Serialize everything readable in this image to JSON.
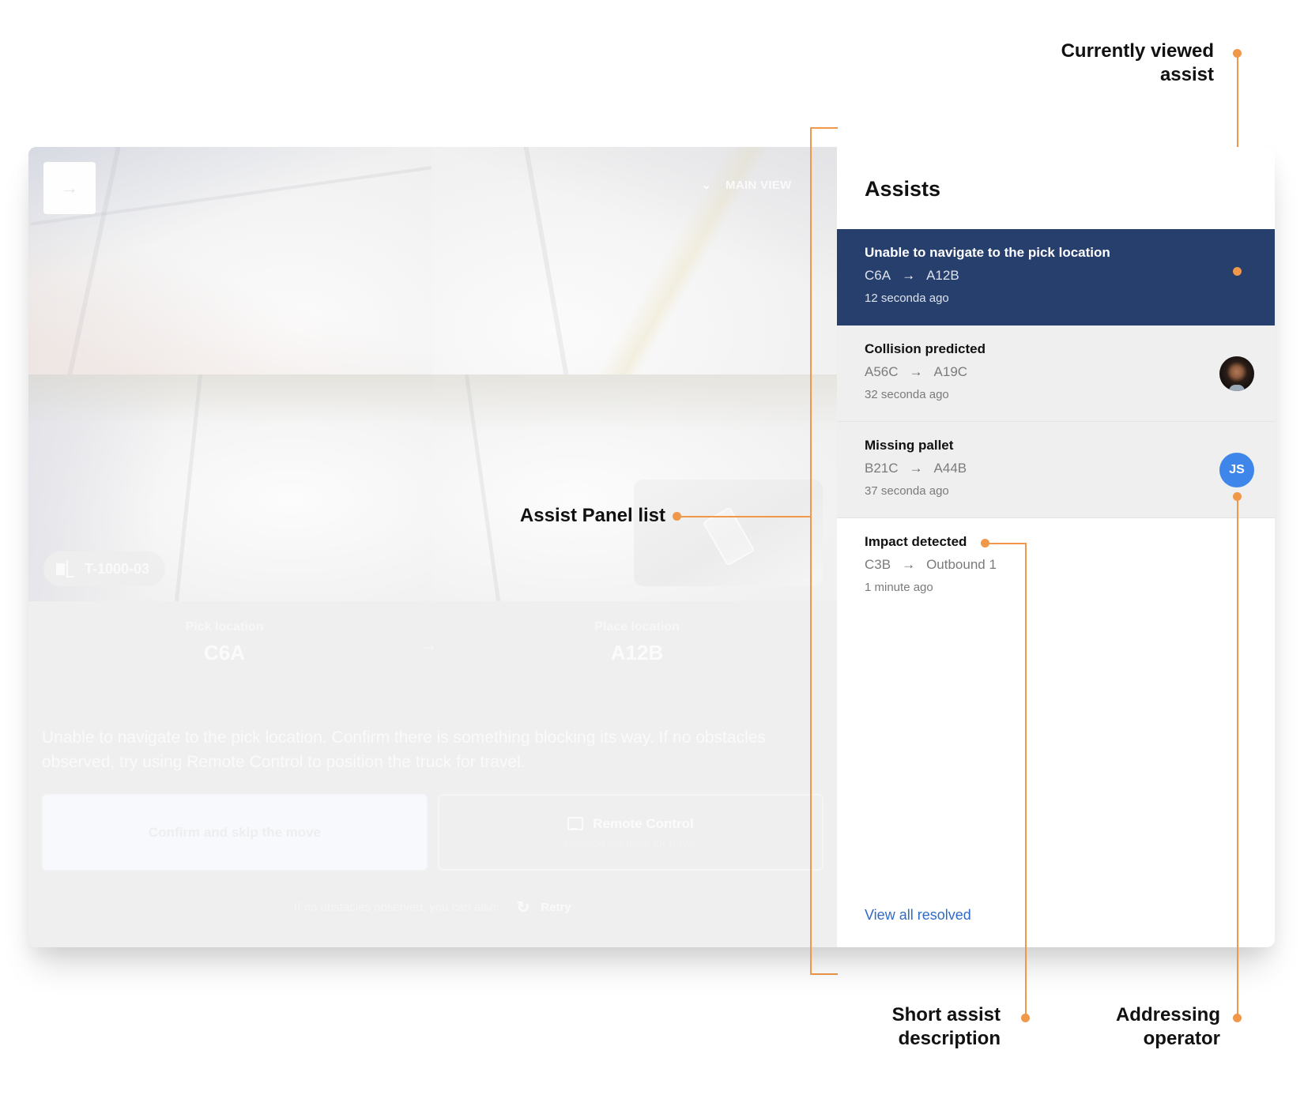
{
  "annotations": {
    "currently_viewed": "Currently viewed assist",
    "currently_viewed_l1": "Currently viewed",
    "currently_viewed_l2": "assist",
    "assist_panel_list": "Assist Panel list",
    "short_desc_l1": "Short assist",
    "short_desc_l2": "description",
    "operator_l1": "Addressing",
    "operator_l2": "operator",
    "accent_color": "#f0974a"
  },
  "main": {
    "back_button_icon": "arrow-right-icon",
    "view_selector": "MAIN VIEW",
    "truck_id": "T-1000-03",
    "pick_label": "Pick location",
    "pick_value": "C6A",
    "place_label": "Place location",
    "place_value": "A12B",
    "description": "Unable to navigate to the pick location. Confirm there is something blocking its way. If no obstacles observed, try using Remote Control to position the truck for travel.",
    "confirm_button": "Confirm and skip the move",
    "remote_button": "Remote Control",
    "remote_sub": "Position the truck for travel",
    "retry_hint": "If no obstacles observed, you can also:",
    "retry_button": "Retry"
  },
  "panel": {
    "title": "Assists",
    "selected_color": "#263f6d",
    "items": [
      {
        "title": "Unable to navigate to the pick location",
        "from": "C6A",
        "to": "A12B",
        "age": "12 seconda ago",
        "selected": true,
        "operator": null
      },
      {
        "title": "Collision predicted",
        "from": "A56C",
        "to": "A19C",
        "age": "32 seconda ago",
        "selected": false,
        "operator": "photo"
      },
      {
        "title": "Missing pallet",
        "from": "B21C",
        "to": "A44B",
        "age": "37 seconda ago",
        "selected": false,
        "operator": "JS"
      },
      {
        "title": "Impact detected",
        "from": "C3B",
        "to": "Outbound 1",
        "age": "1 minute ago",
        "selected": false,
        "operator": null
      }
    ],
    "arrow": "→",
    "view_all": "View all resolved"
  }
}
